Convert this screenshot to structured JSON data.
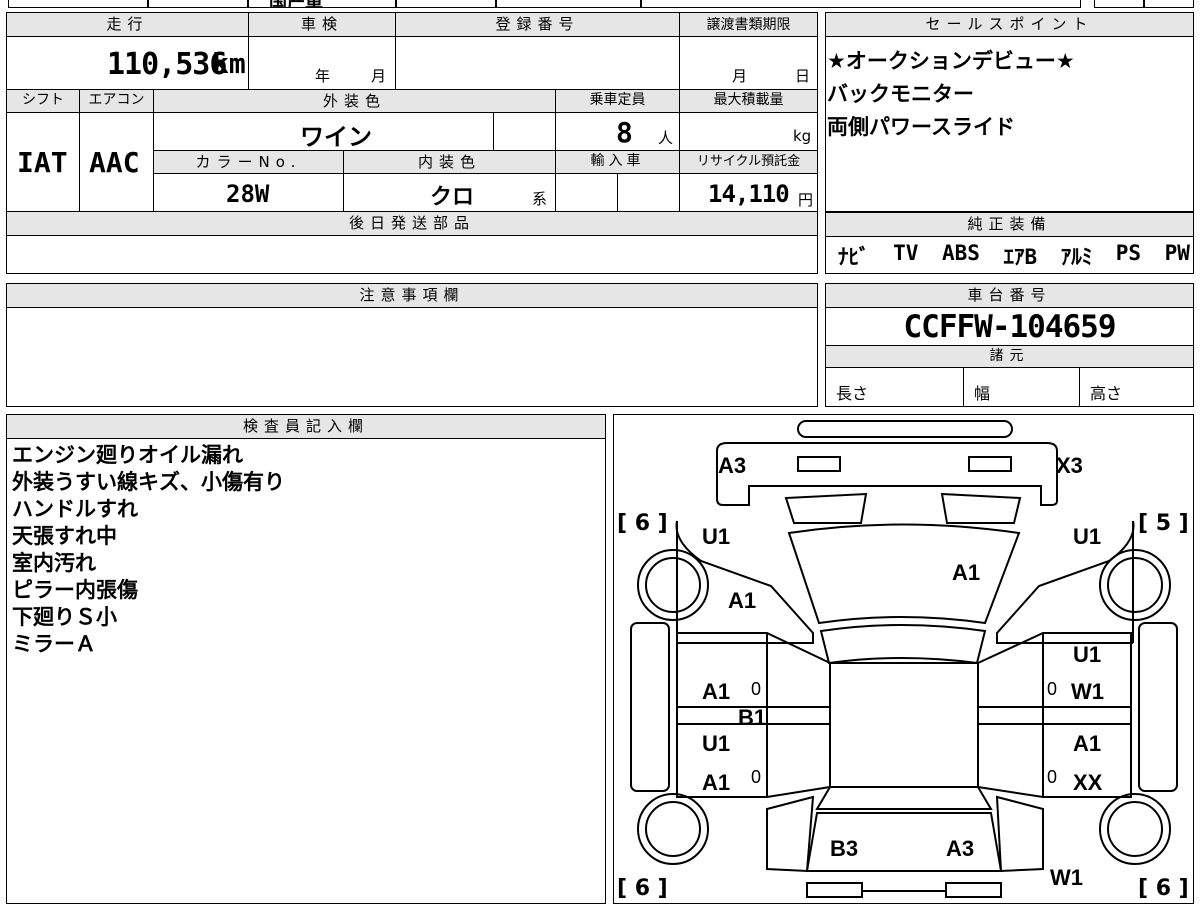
{
  "top_strip": {
    "partial_text": "国产車"
  },
  "vehicle": {
    "mileage_label": "走行",
    "mileage_value": "110,536",
    "mileage_unit": "km",
    "inspection_label": "車検",
    "inspection_year_label": "年",
    "inspection_month_label": "月",
    "registration_label": "登録番号",
    "registration_value": "",
    "transfer_deadline_label": "譲渡書類期限",
    "transfer_month_label": "月",
    "transfer_day_label": "日",
    "shift_label": "シフト",
    "shift_value": "IAT",
    "aircon_label": "エアコン",
    "aircon_value": "AAC",
    "exterior_color_label": "外装色",
    "exterior_color_value": "ワイン",
    "capacity_label": "乗車定員",
    "capacity_value": "8",
    "capacity_unit": "人",
    "max_load_label": "最大積載量",
    "max_load_unit": "kg",
    "color_no_label": "カラーNo.",
    "color_no_value": "28W",
    "interior_color_label": "内装色",
    "interior_color_value": "クロ",
    "interior_color_suffix": "系",
    "import_label": "輸入車",
    "recycle_label": "リサイクル預託金",
    "recycle_value": "14,110",
    "recycle_unit": "円",
    "later_parts_label": "後日発送部品"
  },
  "sales_points": {
    "header": "セールスポイント",
    "lines": [
      "★オークションデビュー★",
      "バックモニター",
      "両側パワースライド"
    ]
  },
  "genuine_equipment": {
    "header": "純正装備",
    "items": [
      "ﾅﾋﾞ",
      "TV",
      "ABS",
      "ｴｱB",
      "ｱﾙﾐ",
      "PS",
      "PW"
    ]
  },
  "notes": {
    "header": "注意事項欄"
  },
  "chassis": {
    "header": "車台番号",
    "value": "CCFFW-104659"
  },
  "specs": {
    "header": "諸元",
    "length_label": "長さ",
    "width_label": "幅",
    "height_label": "高さ"
  },
  "inspector": {
    "header": "検査員記入欄",
    "lines": [
      "エンジン廻りオイル漏れ",
      "外装うすい線キズ、小傷有り",
      "ハンドルすれ",
      "天張すれ中",
      "室内汚れ",
      "ピラー内張傷",
      "下廻りＳ小",
      "ミラーＡ"
    ]
  },
  "diagram": {
    "brackets": {
      "front_left": "[ 6 ]",
      "front_right": "[ 5 ]",
      "rear_left": "[ 6 ]",
      "rear_right": "[ 6 ]"
    },
    "marks": {
      "bumper_left": "A3",
      "bumper_right": "X3",
      "fender_fl": "U1",
      "fender_fr": "U1",
      "hood_left": "A1",
      "hood_right": "A1",
      "door_fl_top": "A1",
      "door_fr_top": "U1",
      "door_fr_mid": "W1",
      "sill_left": "B1",
      "door_rl_top": "U1",
      "door_rl_mid": "A1",
      "door_rr_top": "A1",
      "door_rr_mid": "XX",
      "rear_left": "B3",
      "rear_right": "A3",
      "quarter_rr": "W1",
      "zero": "0"
    }
  }
}
